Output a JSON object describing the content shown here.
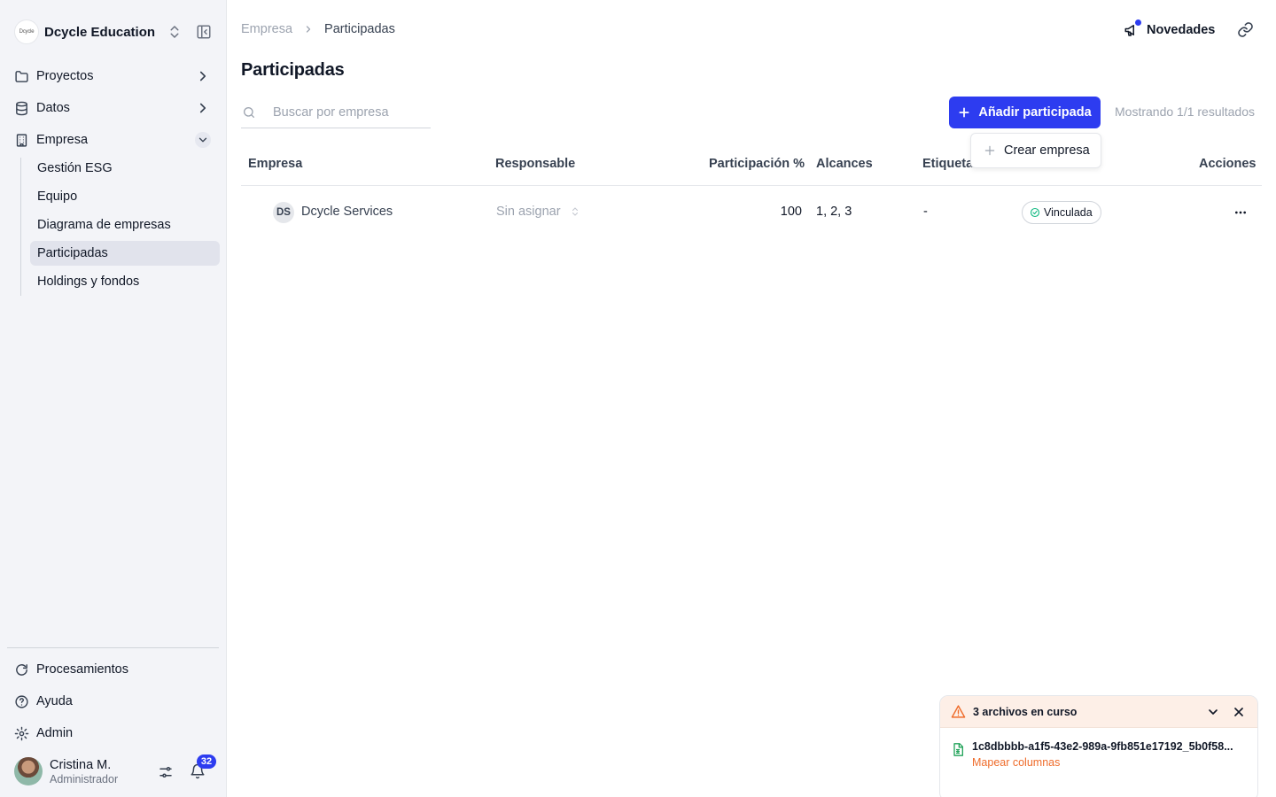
{
  "sidebar": {
    "org_name": "Dcycle Education",
    "org_logo": "Dcycle",
    "nav": [
      {
        "label": "Proyectos",
        "icon": "folder-icon"
      },
      {
        "label": "Datos",
        "icon": "database-icon"
      },
      {
        "label": "Empresa",
        "icon": "building-icon"
      }
    ],
    "empresa_subitems": [
      "Gestión ESG",
      "Equipo",
      "Diagrama de empresas",
      "Participadas",
      "Holdings y fondos"
    ],
    "active_subitem": "Participadas",
    "bottom_nav": [
      {
        "label": "Procesamientos",
        "icon": "refresh-icon"
      },
      {
        "label": "Ayuda",
        "icon": "help-icon"
      },
      {
        "label": "Admin",
        "icon": "gear-icon"
      }
    ],
    "user": {
      "name": "Cristina M.",
      "role": "Administrador",
      "notifications": "32"
    }
  },
  "header": {
    "breadcrumb": [
      "Empresa",
      "Participadas"
    ],
    "novedades_label": "Novedades"
  },
  "main": {
    "title": "Participadas",
    "search_placeholder": "Buscar por empresa",
    "add_button_label": "Añadir participada",
    "results_text": "Mostrando 1/1 resultados",
    "dropdown_item": "Crear empresa",
    "table": {
      "columns": [
        "Empresa",
        "Responsable",
        "Participación %",
        "Alcances",
        "Etiqueta",
        "Acciones"
      ],
      "rows": [
        {
          "initials": "DS",
          "company": "Dcycle Services",
          "responsable": "Sin asignar",
          "participation": "100",
          "alcances": "1, 2, 3",
          "etiquetas": "-",
          "status": "Vinculada"
        }
      ]
    }
  },
  "upload_panel": {
    "title": "3 archivos en curso",
    "file_name": "1c8dbbbb-a1f5-43e2-989a-9fb851e17192_5b0f58...",
    "file_action": "Mapear columnas"
  },
  "colors": {
    "accent": "#2d3cf0",
    "warning": "#ef6c2b",
    "success": "#10b981",
    "sidebar_bg": "#f3f4f8"
  }
}
